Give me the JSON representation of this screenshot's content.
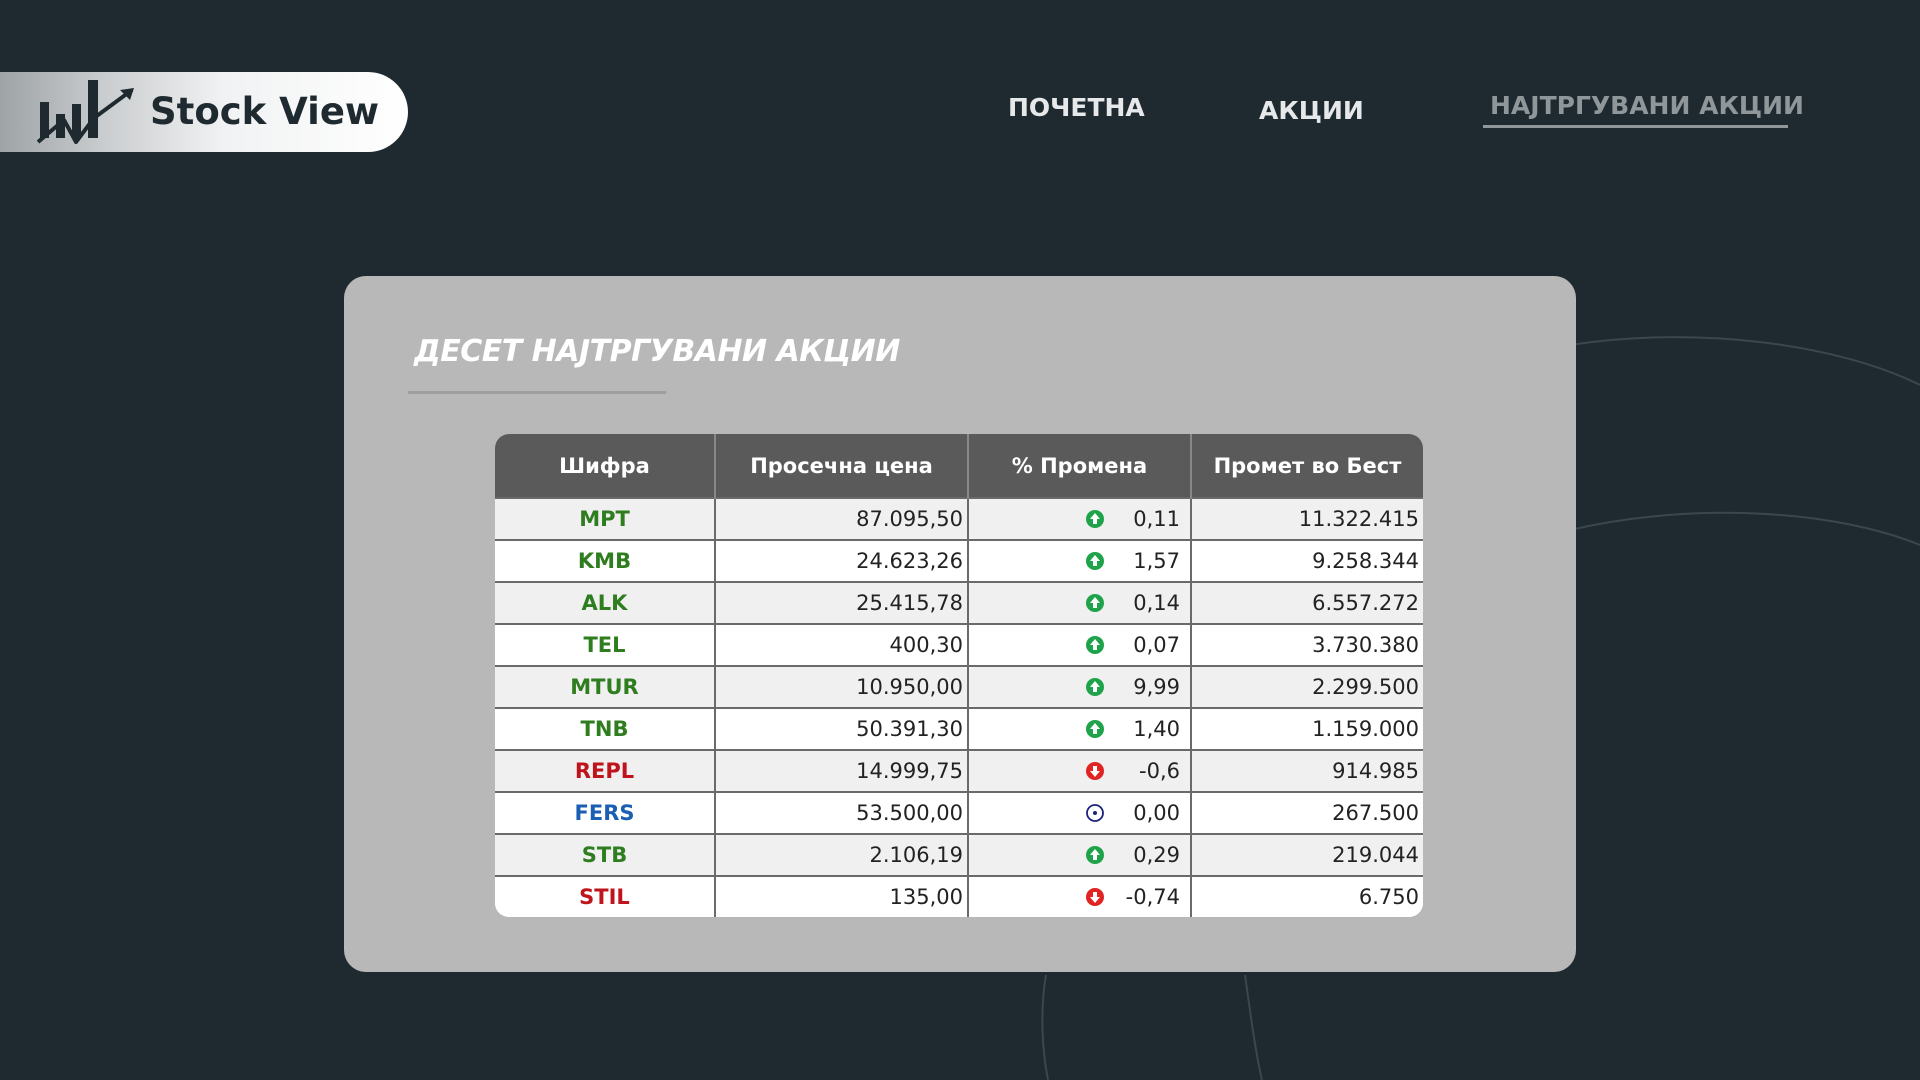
{
  "app": {
    "logo_text": "Stock View",
    "logo_icon": "stock-chart-arrow-icon"
  },
  "nav": {
    "home": "ПОЧЕТНА",
    "stocks": "АКЦИИ",
    "most_traded": "НАЈТРГУВАНИ АКЦИИ",
    "active": "most_traded"
  },
  "card": {
    "title": "ДЕСЕТ НАЈТРГУВАНИ АКЦИИ"
  },
  "table": {
    "headers": [
      "Шифра",
      "Просечна цена",
      "% Промена",
      "Промет во Бест"
    ],
    "rows": [
      {
        "code": "MPT",
        "price": "87.095,50",
        "change": "0,11",
        "direction": "up",
        "turnover": "11.322.415",
        "color": "#2e7d1f"
      },
      {
        "code": "KMB",
        "price": "24.623,26",
        "change": "1,57",
        "direction": "up",
        "turnover": "9.258.344",
        "color": "#2e7d1f"
      },
      {
        "code": "ALK",
        "price": "25.415,78",
        "change": "0,14",
        "direction": "up",
        "turnover": "6.557.272",
        "color": "#2e7d1f"
      },
      {
        "code": "TEL",
        "price": "400,30",
        "change": "0,07",
        "direction": "up",
        "turnover": "3.730.380",
        "color": "#2e7d1f"
      },
      {
        "code": "MTUR",
        "price": "10.950,00",
        "change": "9,99",
        "direction": "up",
        "turnover": "2.299.500",
        "color": "#2e7d1f"
      },
      {
        "code": "TNB",
        "price": "50.391,30",
        "change": "1,40",
        "direction": "up",
        "turnover": "1.159.000",
        "color": "#2e7d1f"
      },
      {
        "code": "REPL",
        "price": "14.999,75",
        "change": "-0,6",
        "direction": "down",
        "turnover": "914.985",
        "color": "#c0141c"
      },
      {
        "code": "FERS",
        "price": "53.500,00",
        "change": "0,00",
        "direction": "flat",
        "turnover": "267.500",
        "color": "#1a5fb4"
      },
      {
        "code": "STB",
        "price": "2.106,19",
        "change": "0,29",
        "direction": "up",
        "turnover": "219.044",
        "color": "#2e7d1f"
      },
      {
        "code": "STIL",
        "price": "135,00",
        "change": "-0,74",
        "direction": "down",
        "turnover": "6.750",
        "color": "#c0141c"
      }
    ]
  },
  "colors": {
    "background": "#1e2a30",
    "card": "#b8b8b8",
    "header": "#5a5a5a",
    "up": "#1fa34a",
    "down": "#e02424",
    "flat": "#1a237e"
  }
}
